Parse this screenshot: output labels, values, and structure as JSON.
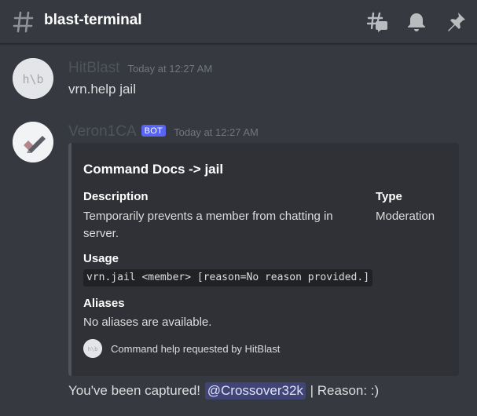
{
  "header": {
    "channel_name": "blast-terminal",
    "icons": [
      "hash-icon",
      "threads-icon",
      "bell-icon",
      "pin-icon"
    ]
  },
  "messages": [
    {
      "author": "HitBlast",
      "timestamp": "Today at 12:27 AM",
      "avatar_text": "h\\b",
      "content": "vrn.help jail"
    },
    {
      "author": "Veron1CA",
      "bot_tag": "BOT",
      "timestamp": "Today at 12:27 AM",
      "avatar_icon": "checkmark-logo-icon",
      "embed": {
        "title": "Command Docs -> jail",
        "fields": {
          "description_name": "Description",
          "description_value": "Temporarily prevents a member from chatting in server.",
          "type_name": "Type",
          "type_value": "Moderation",
          "usage_name": "Usage",
          "usage_value": "vrn.jail <member> [reason=No reason provided.]",
          "aliases_name": "Aliases",
          "aliases_value": "No aliases are available."
        },
        "footer": "Command help requested by HitBlast",
        "accent_color": "#4f545c"
      },
      "followup": {
        "before": "You've been captured! ",
        "mention": "@Crossover32k",
        "after": " | Reason: :)"
      }
    }
  ],
  "colors": {
    "background": "#36393f",
    "embed_bg": "#2f3136",
    "bot_tag": "#5865f2",
    "mention_bg": "#4b54a8"
  }
}
